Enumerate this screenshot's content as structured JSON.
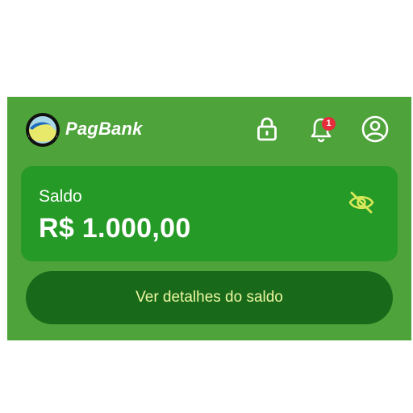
{
  "header": {
    "brand_name": "PagBank",
    "logo_icon": "pagbank-logo-icon",
    "lock_icon": "lock-icon",
    "bell_icon": "bell-icon",
    "notification_count": "1",
    "profile_icon": "user-profile-icon"
  },
  "balance": {
    "label": "Saldo",
    "value": "R$ 1.000,00",
    "visibility_icon": "eye-off-icon"
  },
  "details_button": {
    "label": "Ver detalhes do saldo"
  },
  "colors": {
    "card_background": "#4ea33a",
    "panel_background": "#259a26",
    "button_background": "#186a1a",
    "button_text": "#eef7a0",
    "badge_background": "#e52d3c",
    "accent_yellow": "#d9e85a"
  }
}
